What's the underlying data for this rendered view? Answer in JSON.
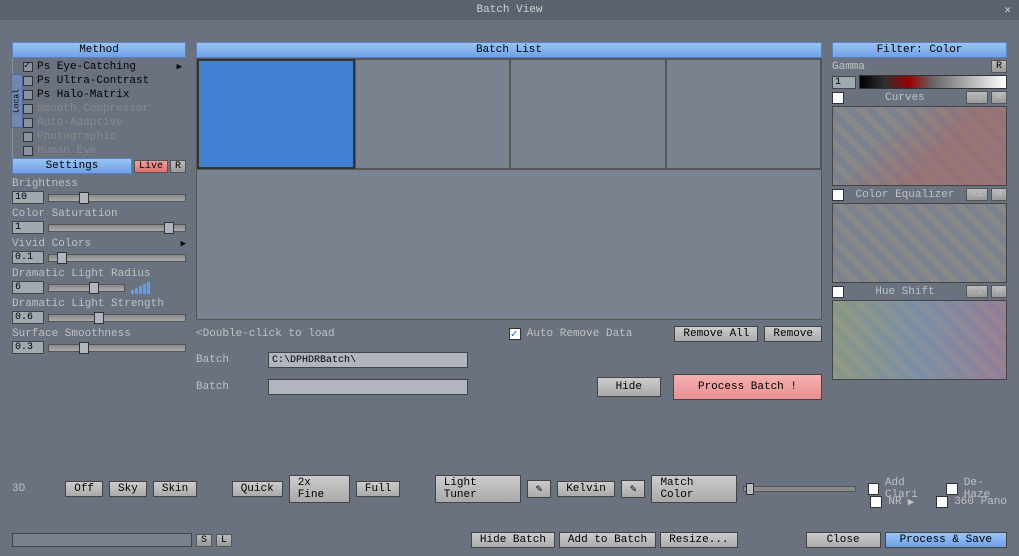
{
  "title": "Batch View",
  "left": {
    "method_hdr": "Method",
    "local_tab": "Local",
    "methods": {
      "m1": "Ps Eye-Catching",
      "m2": "Ps Ultra-Contrast",
      "m3": "Ps Halo-Matrix",
      "m4": "Smooth Compressor",
      "m5": "Auto-Adaptive",
      "m6": "Photographic",
      "m7": "Human Eye"
    },
    "settings_hdr": "Settings",
    "live": "Live",
    "r": "R",
    "sliders": {
      "brightness": {
        "label": "Brightness",
        "val": "10"
      },
      "sat": {
        "label": "Color Saturation",
        "val": "1"
      },
      "vivid": {
        "label": "Vivid Colors",
        "val": "0.1"
      },
      "dradius": {
        "label": "Dramatic Light Radius",
        "val": "6"
      },
      "dstrength": {
        "label": "Dramatic Light Strength",
        "val": "0.6"
      },
      "smooth": {
        "label": "Surface Smoothness",
        "val": "0.3"
      }
    },
    "threeD": "3D"
  },
  "mid": {
    "hdr": "Batch List",
    "hint": "<Double-click to load",
    "auto_remove": "Auto Remove Data",
    "remove_all": "Remove All",
    "remove": "Remove",
    "batch_lbl": "Batch",
    "batch_path": "C:\\DPHDRBatch\\",
    "hide": "Hide",
    "process": "Process Batch !"
  },
  "right": {
    "hdr": "Filter: Color",
    "gamma": "Gamma",
    "gamma_val": "1",
    "r": "R",
    "curves": "Curves",
    "dotdot": "..",
    "coloreq": "Color Equalizer",
    "x1": "x1",
    "hue": "Hue Shift",
    "addclari": "Add Clari",
    "dehaze": "De-Haze",
    "nr": "NR",
    "pano": "360 Pano"
  },
  "bot": {
    "off": "Off",
    "sky": "Sky",
    "skin": "Skin",
    "quick": "Quick",
    "x2fine": "2x Fine",
    "full": "Full",
    "lighttuner": "Light Tuner",
    "kelvin": "Kelvin",
    "matchcolor": "Match Color"
  },
  "footer": {
    "s": "S",
    "l": "L",
    "hidebatch": "Hide Batch",
    "addbatch": "Add to Batch",
    "resize": "Resize...",
    "close": "Close",
    "processsave": "Process & Save"
  }
}
